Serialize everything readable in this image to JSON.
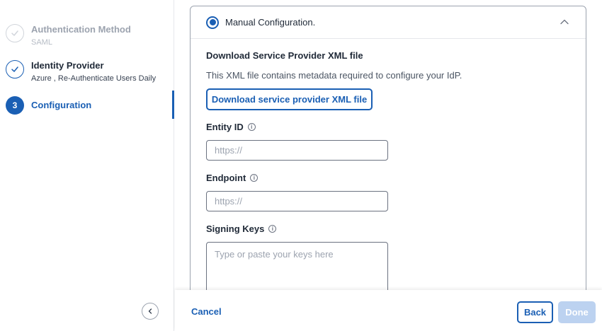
{
  "steps": [
    {
      "title": "Authentication Method",
      "subtitle": "SAML",
      "state": "completed"
    },
    {
      "title": "Identity Provider",
      "subtitle": "Azure , Re-Authenticate Users Daily",
      "state": "completed"
    },
    {
      "number": "3",
      "title": "Configuration",
      "state": "active"
    }
  ],
  "config": {
    "option_label": "Manual Configuration.",
    "download_title": "Download Service Provider XML file",
    "download_description": "This XML file contains metadata required to configure your IdP.",
    "download_button": "Download service provider XML file",
    "entity_id": {
      "label": "Entity ID",
      "placeholder": "https://",
      "value": ""
    },
    "endpoint": {
      "label": "Endpoint",
      "placeholder": "https://",
      "value": ""
    },
    "signing_keys": {
      "label": "Signing Keys",
      "placeholder": "Type or paste your keys here",
      "value": ""
    },
    "info_glyph": "i"
  },
  "footer": {
    "cancel_label": "Cancel",
    "back_label": "Back",
    "done_label": "Done"
  },
  "colors": {
    "accent": "#1a5fb4",
    "disabled_button": "#bcd2f0",
    "completed_step": "#d1d5db"
  },
  "icons": {
    "step_completed": "checkmark-icon",
    "collapse": "chevron-left-icon",
    "accordion_toggle": "chevron-up-icon",
    "field_help": "info-icon"
  }
}
